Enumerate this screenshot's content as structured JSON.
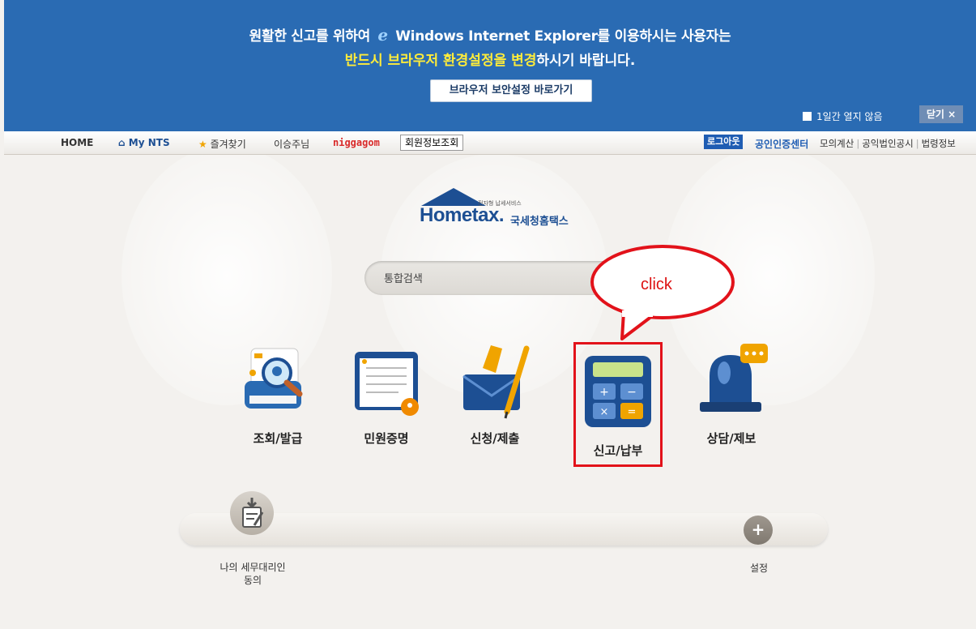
{
  "banner": {
    "line1_a": "원활한 신고를 위하여 ",
    "ie_glyph": "e",
    "line1_b": " Windows Internet Explorer를 이용하시는 사용자는",
    "line2_highlight": "반드시 브라우저 환경설정을 변경",
    "line2_rest": "하시기 바랍니다.",
    "button_label": "브라우저 보안설정 바로가기",
    "no_display_label": "1일간 열지 않음",
    "close_label": "닫기 ×"
  },
  "nav": {
    "home": "HOME",
    "my_nts": "My NTS",
    "favorites": "즐겨찾기",
    "user_greeting": "이승주님",
    "username": "niggagom",
    "member_info": "회원정보조회",
    "logout": "로그아웃",
    "cert_center": "공인인증센터",
    "links": [
      "모의계산",
      "공익법인공시",
      "법령정보"
    ]
  },
  "logo": {
    "mini_text": "전자형 납세서비스",
    "brand": "Hometax.",
    "korean": "국세청홈택스"
  },
  "search": {
    "placeholder": "통합검색"
  },
  "callout": {
    "text": "click"
  },
  "menu": [
    {
      "label": "조회/발급"
    },
    {
      "label": "민원증명"
    },
    {
      "label": "신청/제출"
    },
    {
      "label": "신고/납부"
    },
    {
      "label": "상담/제보"
    }
  ],
  "shelf": {
    "left_label_line1": "나의 세무대리인",
    "left_label_line2": "동의",
    "right_label": "설정",
    "plus_glyph": "+"
  },
  "colors": {
    "banner_bg": "#2a6bb3",
    "highlight_yellow": "#ffec3a",
    "callout_red": "#e2121a",
    "brand_blue": "#1d4f93"
  }
}
